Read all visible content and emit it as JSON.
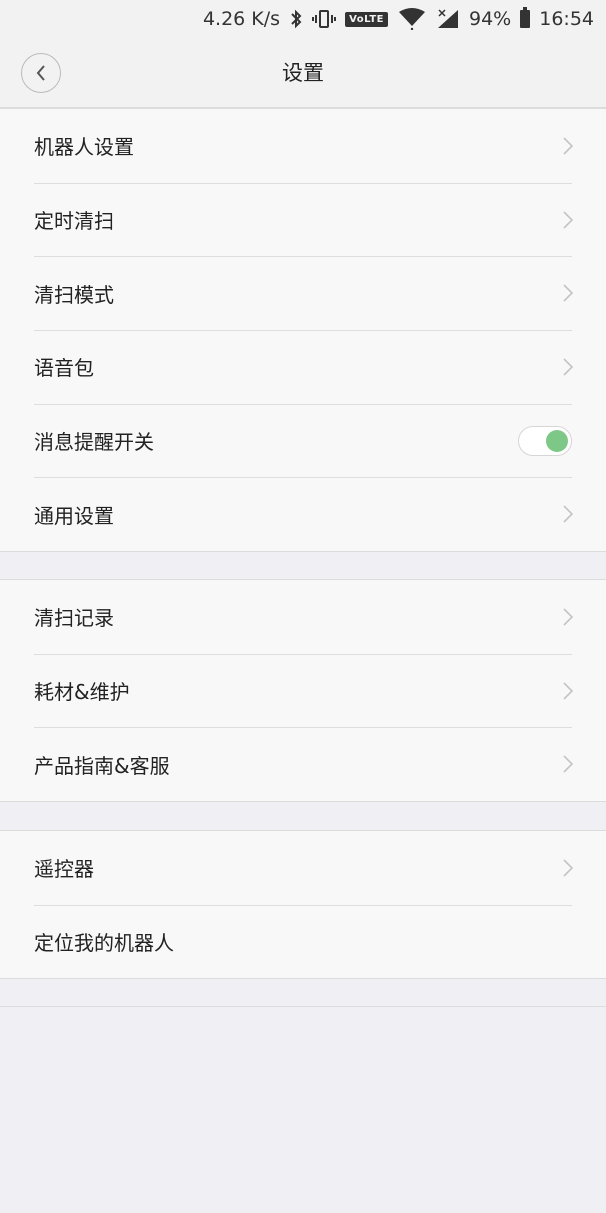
{
  "status_bar": {
    "speed": "4.26 K/s",
    "volte": "VoLTE",
    "battery": "94%",
    "time": "16:54"
  },
  "header": {
    "title": "设置"
  },
  "groups": [
    {
      "items": [
        {
          "label": "机器人设置",
          "control": "chevron"
        },
        {
          "label": "定时清扫",
          "control": "chevron"
        },
        {
          "label": "清扫模式",
          "control": "chevron"
        },
        {
          "label": "语音包",
          "control": "chevron"
        },
        {
          "label": "消息提醒开关",
          "control": "toggle",
          "toggle_on": true
        },
        {
          "label": "通用设置",
          "control": "chevron"
        }
      ]
    },
    {
      "items": [
        {
          "label": "清扫记录",
          "control": "chevron"
        },
        {
          "label": "耗材&维护",
          "control": "chevron"
        },
        {
          "label": "产品指南&客服",
          "control": "chevron"
        }
      ]
    },
    {
      "items": [
        {
          "label": "遥控器",
          "control": "chevron"
        },
        {
          "label": "定位我的机器人",
          "control": "none"
        }
      ]
    }
  ],
  "colors": {
    "toggle_on": "#7ec887",
    "background": "#efeff4",
    "row_background": "#f8f8f8"
  }
}
